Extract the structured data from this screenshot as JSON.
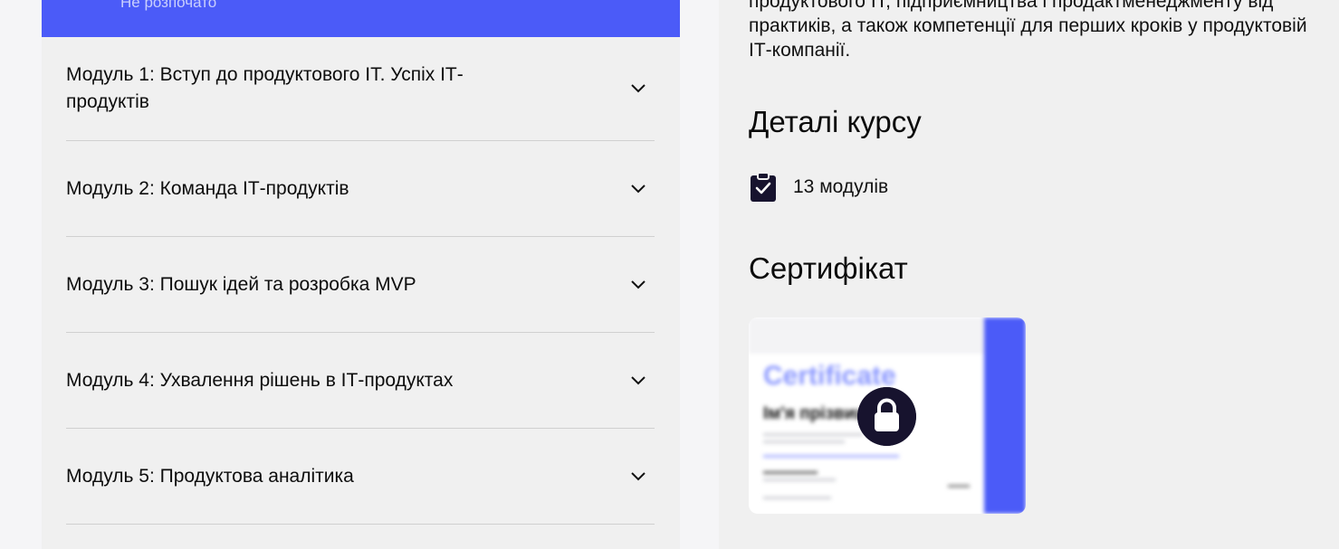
{
  "modules_panel": {
    "status_text": "Не розпочато",
    "modules": [
      {
        "title": "Модуль 1: Вступ до продуктового ІТ. Успіх ІТ-продуктів"
      },
      {
        "title": "Модуль 2: Команда ІТ-продуктів"
      },
      {
        "title": "Модуль 3: Пошук ідей та розробка MVP"
      },
      {
        "title": "Модуль 4: Ухвалення рішень в ІТ-продуктах"
      },
      {
        "title": "Модуль 5: Продуктова аналітика"
      }
    ]
  },
  "course_info": {
    "description": "продуктового ІТ, підприємництва і продактменеджменту від практиків, а також компетенції для перших кроків у продуктовій ІТ-компанії.",
    "details_heading": "Деталі курсу",
    "modules_count": "13 модулів",
    "modules_icon": "clipboard-check-icon",
    "certificate_heading": "Сертифікат",
    "certificate_preview": {
      "title": "Certificate",
      "name": "Ім'я прізвище",
      "lock_icon": "lock-icon"
    }
  },
  "colors": {
    "accent": "#4b5bf8",
    "panel_bg": "#f0f0f0",
    "lock_bg": "#17132e"
  }
}
